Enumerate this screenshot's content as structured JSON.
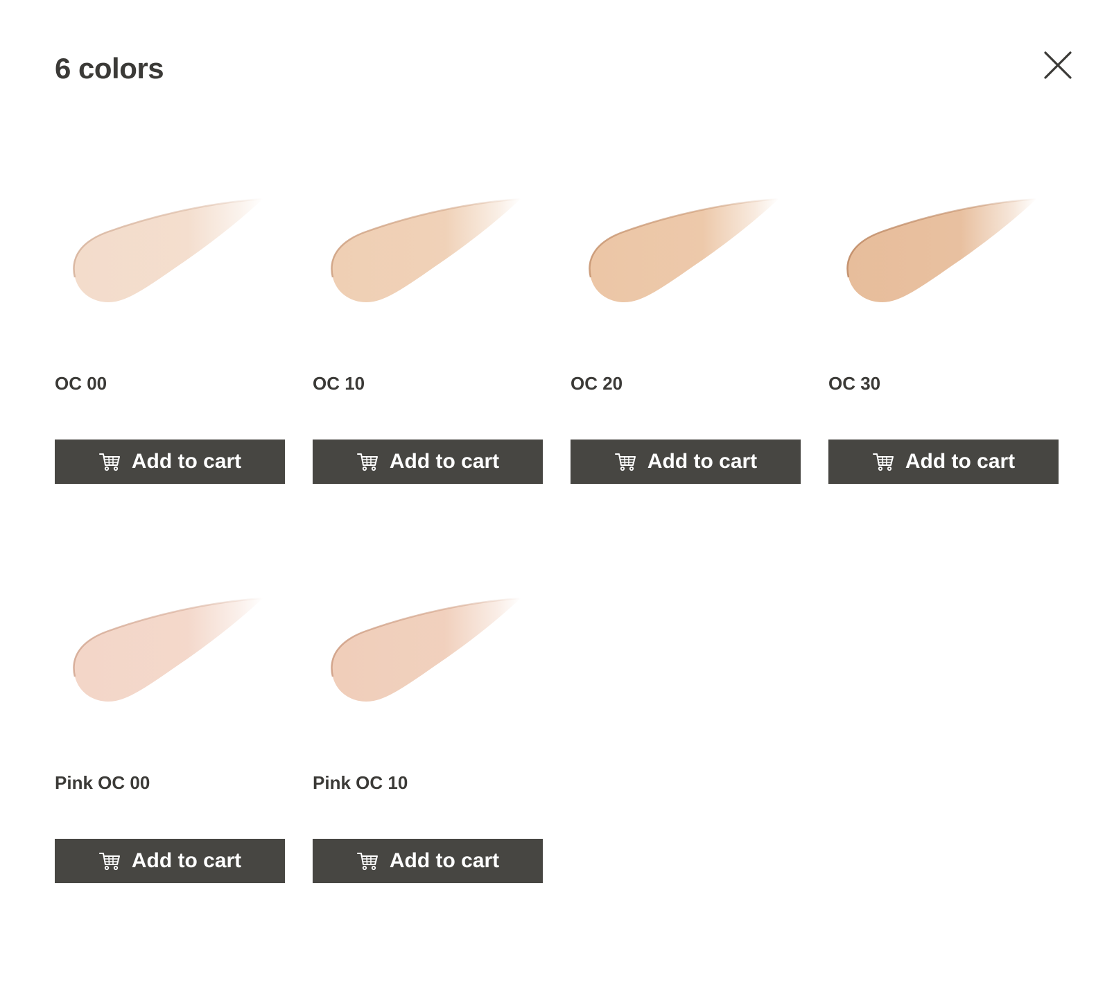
{
  "modal": {
    "title": "6 colors",
    "close_icon": "close-icon"
  },
  "swatches": [
    {
      "name": "OC 00",
      "button_label": "Add to cart",
      "icon": "cart-icon",
      "color": "#f3dccb",
      "edge": "#d7b39c"
    },
    {
      "name": "OC 10",
      "button_label": "Add to cart",
      "icon": "cart-icon",
      "color": "#efcfb4",
      "edge": "#cfa283"
    },
    {
      "name": "OC 20",
      "button_label": "Add to cart",
      "icon": "cart-icon",
      "color": "#ecc6a6",
      "edge": "#c89672"
    },
    {
      "name": "OC 30",
      "button_label": "Add to cart",
      "icon": "cart-icon",
      "color": "#e7bd9b",
      "edge": "#bf8a65"
    },
    {
      "name": "Pink OC 00",
      "button_label": "Add to cart",
      "icon": "cart-icon",
      "color": "#f3d6c8",
      "edge": "#d4a994"
    },
    {
      "name": "Pink OC 10",
      "button_label": "Add to cart",
      "icon": "cart-icon",
      "color": "#f0ceba",
      "edge": "#cf9f85"
    }
  ],
  "colors": {
    "button_bg": "#474642",
    "text": "#3b3a37"
  }
}
